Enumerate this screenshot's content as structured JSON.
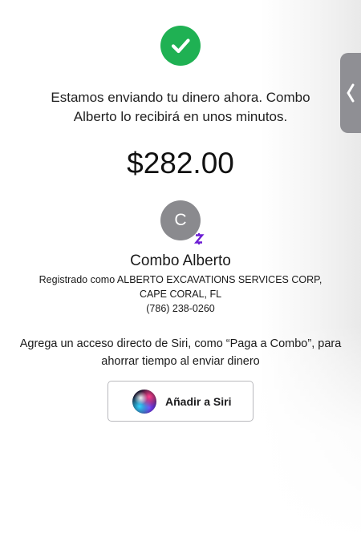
{
  "confirmation": {
    "message": "Estamos enviando tu dinero ahora. Combo Alberto lo recibirá en unos minutos.",
    "amount": "$282.00"
  },
  "recipient": {
    "avatar_initial": "C",
    "badge_icon": "zelle-icon",
    "name": "Combo Alberto",
    "registered_line": "Registrado como ALBERTO EXCAVATIONS SERVICES CORP,",
    "location": "CAPE CORAL, FL",
    "phone": "(786) 238-0260"
  },
  "siri": {
    "prompt": "Agrega un acceso directo de Siri, como “Paga a Combo”, para ahorrar tiempo al enviar dinero",
    "button_label": "Añadir a Siri",
    "icon": "siri-icon"
  },
  "colors": {
    "success": "#1fb153",
    "avatar": "#8a8a8e",
    "zelle": "#6d1ed4",
    "handle": "#8f8f94"
  },
  "icons": {
    "status": "checkmark-icon",
    "side_handle": "chevron-left-icon"
  }
}
